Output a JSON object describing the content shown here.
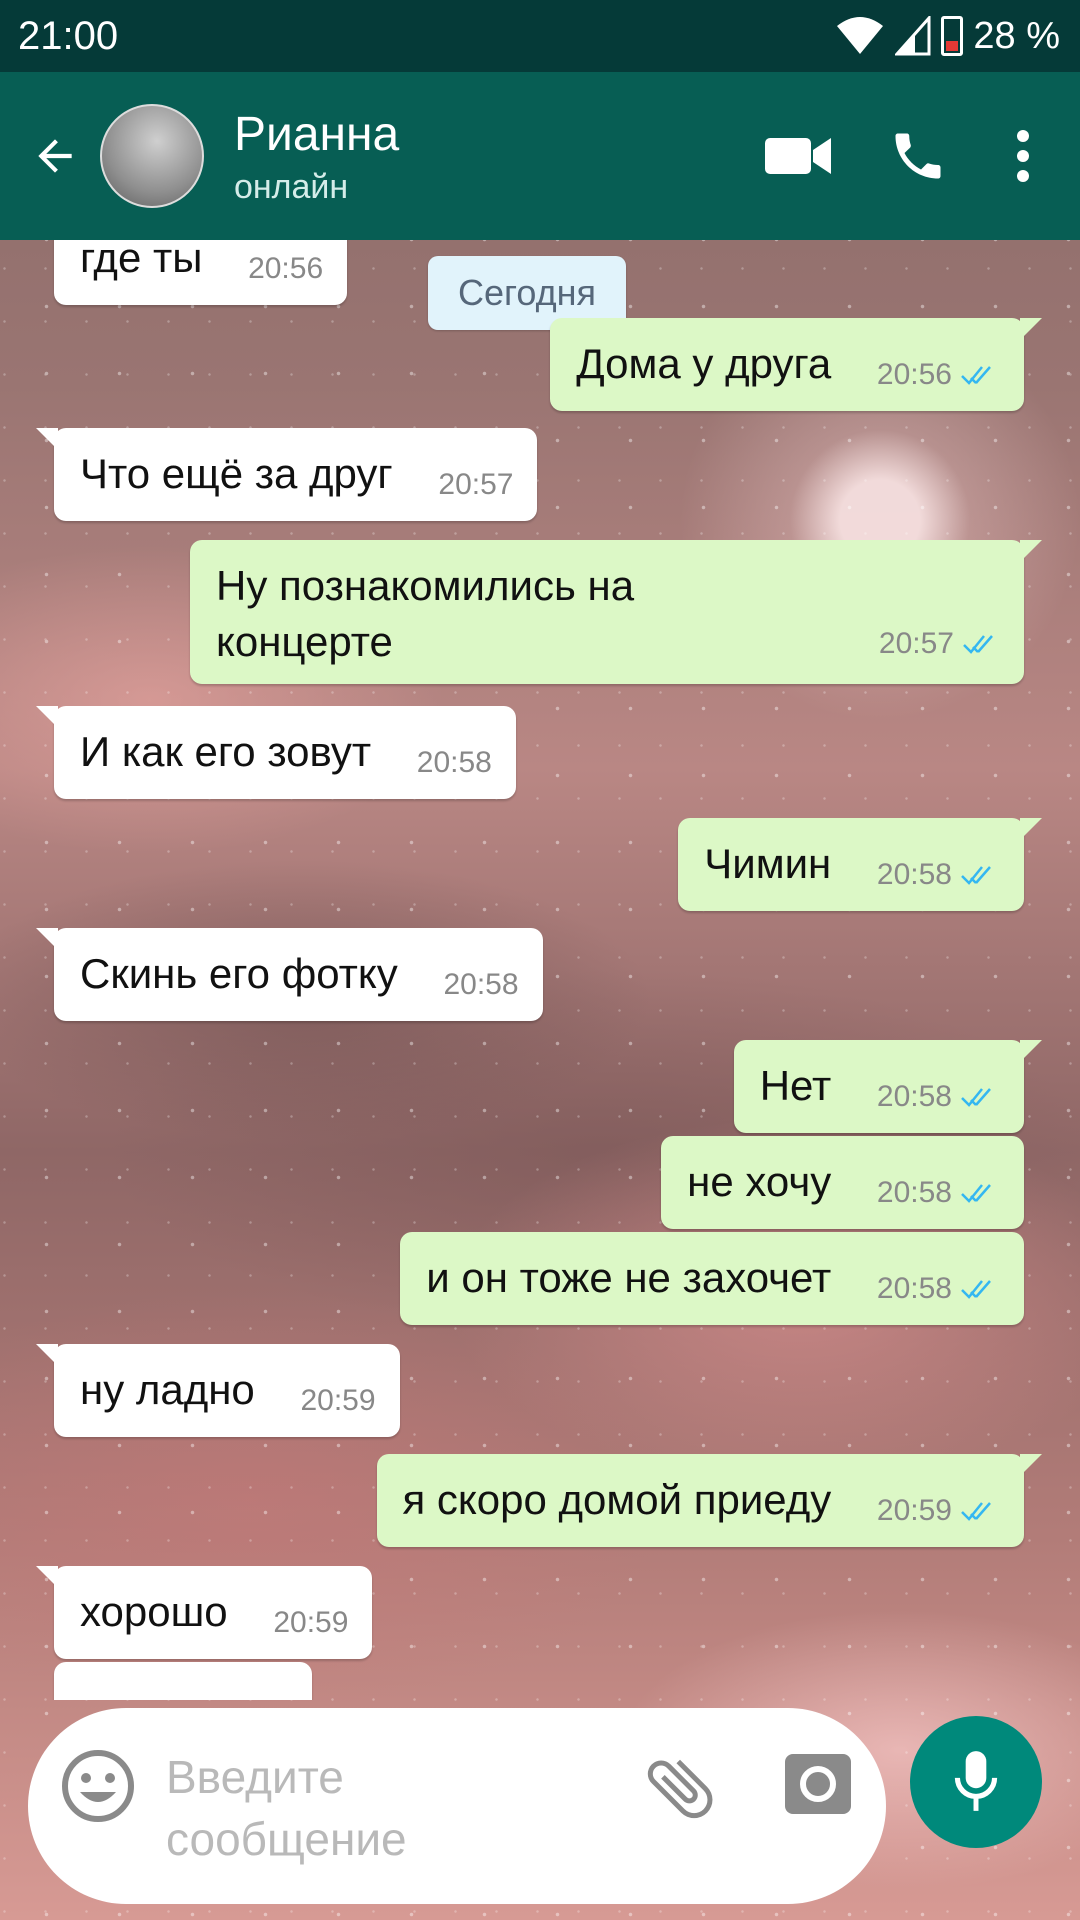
{
  "status_bar": {
    "time": "21:00",
    "battery": "28 %"
  },
  "header": {
    "name": "Рианна",
    "status": "онлайн"
  },
  "date_chip": "Сегодня",
  "messages": [
    {
      "dir": "in",
      "text": "где ты",
      "time": "20:56"
    },
    {
      "dir": "out",
      "text": "Дома у друга",
      "time": "20:56"
    },
    {
      "dir": "in",
      "text": "Что ещё за друг",
      "time": "20:57"
    },
    {
      "dir": "out",
      "text": "Ну познакомились на концерте",
      "time": "20:57"
    },
    {
      "dir": "in",
      "text": "И как его зовут",
      "time": "20:58"
    },
    {
      "dir": "out",
      "text": "Чимин",
      "time": "20:58"
    },
    {
      "dir": "in",
      "text": "Скинь его фотку",
      "time": "20:58"
    },
    {
      "dir": "out",
      "text": "Нет",
      "time": "20:58"
    },
    {
      "dir": "out",
      "text": "не хочу",
      "time": "20:58"
    },
    {
      "dir": "out",
      "text": "и он тоже не захочет",
      "time": "20:58"
    },
    {
      "dir": "in",
      "text": "ну ладно",
      "time": "20:59"
    },
    {
      "dir": "out",
      "text": "я скоро домой приеду",
      "time": "20:59"
    },
    {
      "dir": "in",
      "text": "хорошо",
      "time": "20:59"
    }
  ],
  "input": {
    "placeholder": "Введите сообщение"
  },
  "icons": {
    "back": "arrow-back-icon",
    "video": "video-call-icon",
    "call": "phone-icon",
    "menu": "more-vert-icon",
    "emoji": "emoji-icon",
    "attach": "paperclip-icon",
    "camera": "camera-icon",
    "mic": "microphone-icon"
  },
  "colors": {
    "status_bar": "#053a38",
    "app_bar": "#075e54",
    "incoming_bubble": "#ffffff",
    "outgoing_bubble": "#dcf8c6",
    "read_ticks": "#34b7f1",
    "mic_button": "#00897b"
  }
}
